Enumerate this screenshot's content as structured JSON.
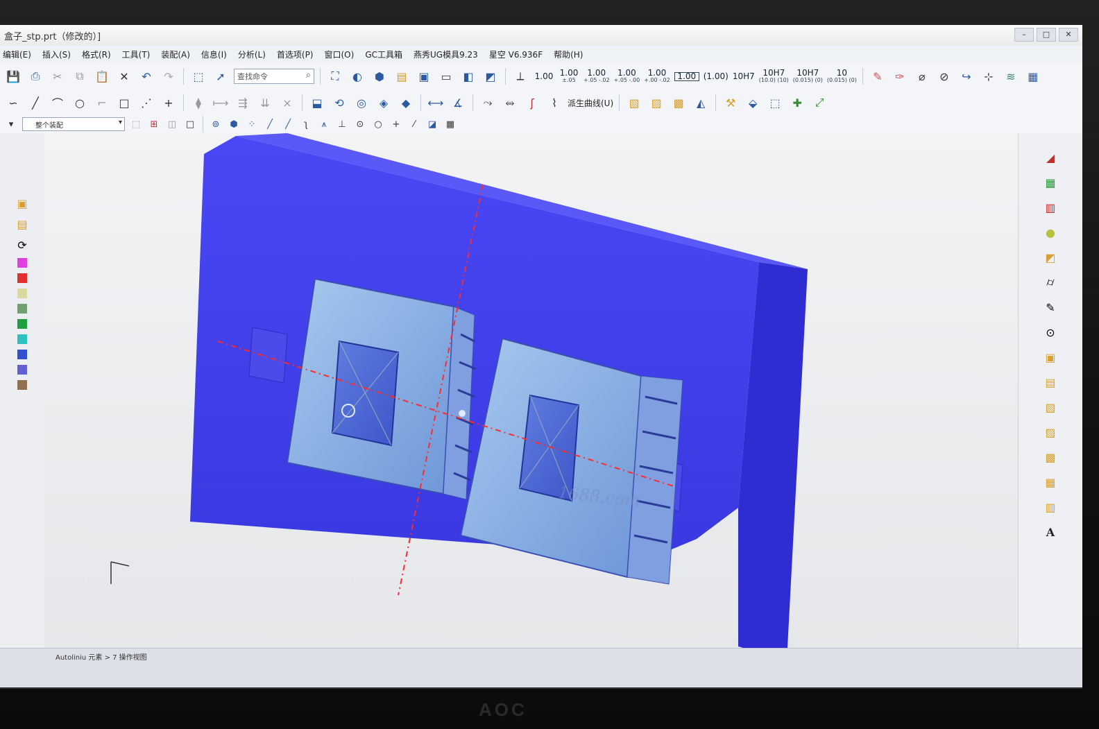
{
  "window": {
    "title": "盒子_stp.prt（修改的）]"
  },
  "menu": [
    "编辑(E)",
    "插入(S)",
    "格式(R)",
    "工具(T)",
    "装配(A)",
    "信息(I)",
    "分析(L)",
    "首选项(P)",
    "窗口(O)",
    "GC工具箱",
    "燕秀UG模具9.23",
    "星空 V6.936F",
    "帮助(H)"
  ],
  "toolbar": {
    "command_search_placeholder": "查找命令",
    "tolerances": [
      {
        "main": "1.00",
        "sub": ""
      },
      {
        "main": "1.00",
        "sub": "±.05"
      },
      {
        "main": "1.00",
        "sub": "+.05 -.02"
      },
      {
        "main": "1.00",
        "sub": "+.05 -.00"
      },
      {
        "main": "1.00",
        "sub": "+.00 -.02"
      },
      {
        "main": "1.00",
        "sub": "",
        "boxed": true
      },
      {
        "main": "(1.00)",
        "sub": ""
      },
      {
        "main": "10H7",
        "sub": ""
      },
      {
        "main": "10H7",
        "sub": "(10.0) (10)"
      },
      {
        "main": "10H7",
        "sub": "(0.015) (0)"
      },
      {
        "main": "10",
        "sub": "(0.015) (0)"
      }
    ],
    "derived_curve_label": "派生曲线(U)",
    "selection_filter": "整个装配"
  },
  "viewport": {
    "watermark": "1688.com",
    "mold_color": "#3f3ff0",
    "part_color": "#8fb8e8",
    "axis_color": "#ff2a2a"
  },
  "status": {
    "text": "Autoliniu 元素 > 7 操作视图"
  },
  "monitor": {
    "brand": "AOC"
  },
  "left_swatches": [
    "#e040e0",
    "#e03030",
    "#d9d9a0",
    "#70a070",
    "#20a040",
    "#30c0c0",
    "#3050d0",
    "#6060d0",
    "#907050"
  ]
}
